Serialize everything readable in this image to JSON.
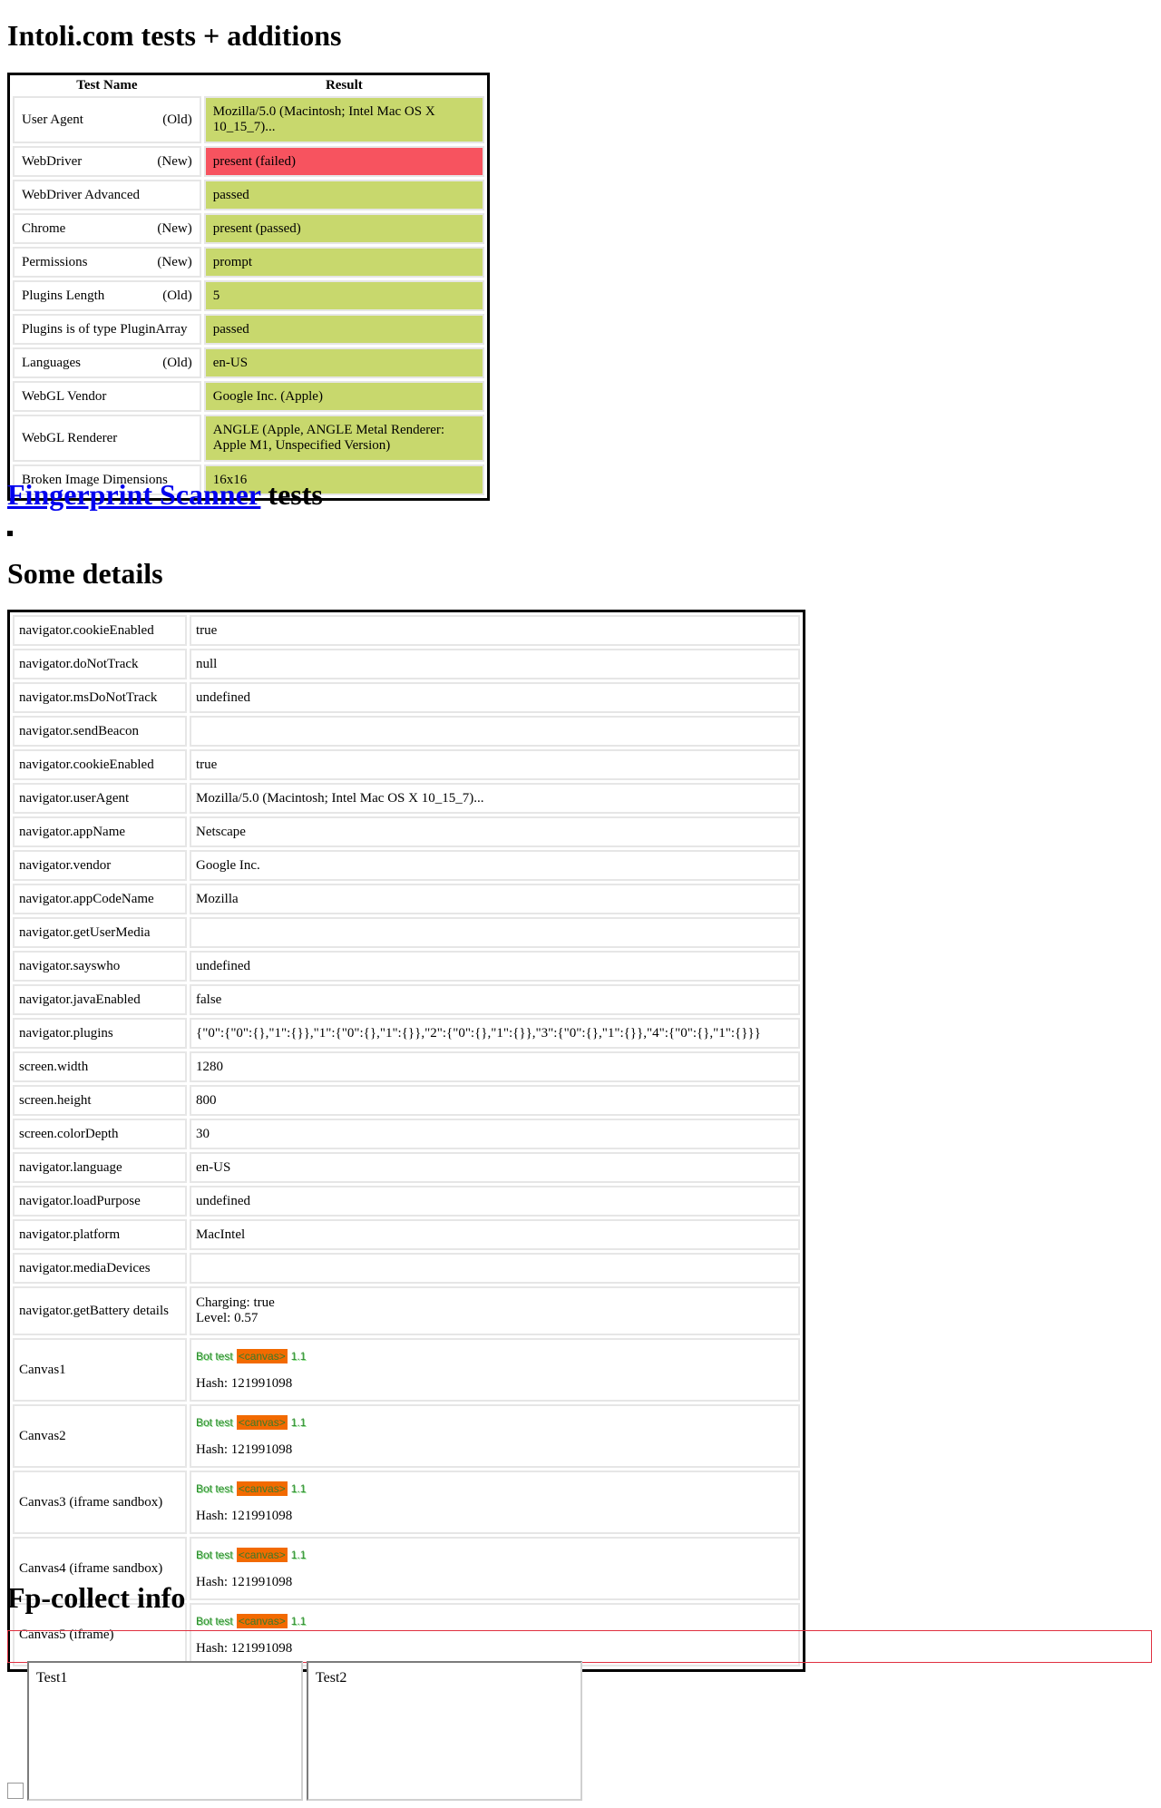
{
  "intoli": {
    "heading": "Intoli.com tests + additions",
    "headers": {
      "name": "Test Name",
      "result": "Result"
    },
    "rows": [
      {
        "name": "User Agent",
        "tag": "(Old)",
        "result": "Mozilla/5.0 (Macintosh; Intel Mac OS X 10_15_7)...",
        "status": "pass"
      },
      {
        "name": "WebDriver",
        "tag": "(New)",
        "result": "present (failed)",
        "status": "fail"
      },
      {
        "name": "WebDriver Advanced",
        "tag": "",
        "result": "passed",
        "status": "pass"
      },
      {
        "name": "Chrome",
        "tag": "(New)",
        "result": "present (passed)",
        "status": "pass"
      },
      {
        "name": "Permissions",
        "tag": "(New)",
        "result": "prompt",
        "status": "pass"
      },
      {
        "name": "Plugins Length",
        "tag": "(Old)",
        "result": "5",
        "status": "pass"
      },
      {
        "name": "Plugins is of type PluginArray",
        "tag": "",
        "result": "passed",
        "status": "pass"
      },
      {
        "name": "Languages",
        "tag": "(Old)",
        "result": "en-US",
        "status": "pass"
      },
      {
        "name": "WebGL Vendor",
        "tag": "",
        "result": "Google Inc. (Apple)",
        "status": "pass"
      },
      {
        "name": "WebGL Renderer",
        "tag": "",
        "result": "ANGLE (Apple, ANGLE Metal Renderer: Apple M1, Unspecified Version)",
        "status": "pass"
      },
      {
        "name": "Broken Image Dimensions",
        "tag": "",
        "result": "16x16",
        "status": "pass"
      }
    ]
  },
  "fingerprint": {
    "link_text": "Fingerprint Scanner",
    "suffix": " tests"
  },
  "details": {
    "heading": "Some details",
    "rows": [
      {
        "key": "navigator.cookieEnabled",
        "value": "true"
      },
      {
        "key": "navigator.doNotTrack",
        "value": "null"
      },
      {
        "key": "navigator.msDoNotTrack",
        "value": "undefined"
      },
      {
        "key": "navigator.sendBeacon",
        "value": ""
      },
      {
        "key": "navigator.cookieEnabled",
        "value": "true"
      },
      {
        "key": "navigator.userAgent",
        "value": "Mozilla/5.0 (Macintosh; Intel Mac OS X 10_15_7)..."
      },
      {
        "key": "navigator.appName",
        "value": "Netscape"
      },
      {
        "key": "navigator.vendor",
        "value": "Google Inc."
      },
      {
        "key": "navigator.appCodeName",
        "value": "Mozilla"
      },
      {
        "key": "navigator.getUserMedia",
        "value": ""
      },
      {
        "key": "navigator.sayswho",
        "value": "undefined"
      },
      {
        "key": "navigator.javaEnabled",
        "value": "false"
      },
      {
        "key": "navigator.plugins",
        "value": "{\"0\":{\"0\":{},\"1\":{}},\"1\":{\"0\":{},\"1\":{}},\"2\":{\"0\":{},\"1\":{}},\"3\":{\"0\":{},\"1\":{}},\"4\":{\"0\":{},\"1\":{}}}"
      },
      {
        "key": "screen.width",
        "value": "1280"
      },
      {
        "key": "screen.height",
        "value": "800"
      },
      {
        "key": "screen.colorDepth",
        "value": "30"
      },
      {
        "key": "navigator.language",
        "value": "en-US"
      },
      {
        "key": "navigator.loadPurpose",
        "value": "undefined"
      },
      {
        "key": "navigator.platform",
        "value": "MacIntel"
      },
      {
        "key": "navigator.mediaDevices",
        "value": ""
      }
    ],
    "battery": {
      "key": "navigator.getBattery details",
      "line1": "Charging: true",
      "line2": "Level: 0.57"
    },
    "canvas": [
      {
        "key": "Canvas1",
        "img_text1": "Bot test",
        "img_tag": "<canvas>",
        "img_text2": "1.1",
        "hash": "Hash: 121991098"
      },
      {
        "key": "Canvas2",
        "img_text1": "Bot test",
        "img_tag": "<canvas>",
        "img_text2": "1.1",
        "hash": "Hash: 121991098"
      },
      {
        "key": "Canvas3 (iframe sandbox)",
        "img_text1": "Bot test",
        "img_tag": "<canvas>",
        "img_text2": "1.1",
        "hash": "Hash: 121991098"
      },
      {
        "key": "Canvas4 (iframe sandbox)",
        "img_text1": "Bot test",
        "img_tag": "<canvas>",
        "img_text2": "1.1",
        "hash": "Hash: 121991098"
      },
      {
        "key": "Canvas5 (iframe)",
        "img_text1": "Bot test",
        "img_tag": "<canvas>",
        "img_text2": "1.1",
        "hash": "Hash: 121991098"
      }
    ]
  },
  "fpcollect": {
    "heading": "Fp-collect info",
    "frames": [
      "Test1",
      "Test2"
    ],
    "broken_image_icon": "broken-image-icon"
  },
  "colors": {
    "pass": "#c8d86d",
    "fail": "#f7535f",
    "link": "#0000ee",
    "box_border": "#e03040"
  }
}
